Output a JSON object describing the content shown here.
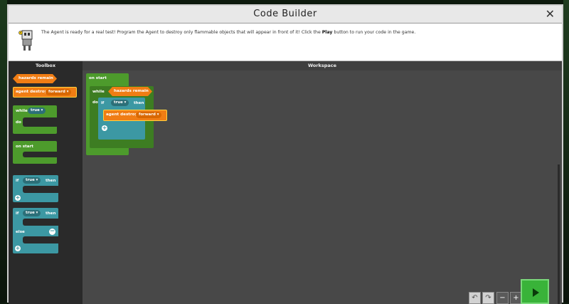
{
  "window": {
    "title": "Code Builder",
    "close_glyph": "✕"
  },
  "info": {
    "text_before": "The Agent is ready for a real test! Program the Agent to destroy only flammable objects that will appear in front of it! Click the ",
    "bold": "Play",
    "text_after": " button to run your code in the game."
  },
  "toolbox": {
    "header": "Toolbox",
    "hazards_label": "hazards remain",
    "agent_destroy_label": "agent destroy",
    "forward_label": "forward ▾",
    "while_label": "while",
    "true_label": "true ▾",
    "do_label": "do",
    "on_start_label": "on start",
    "if_label": "if",
    "then_label": "then",
    "else_label": "else"
  },
  "workspace": {
    "header": "Workspace",
    "on_start_label": "on start",
    "while_label": "while",
    "hazards_label": "hazards remain",
    "do_label": "do",
    "if_label": "if",
    "true_label": "true ▾",
    "then_label": "then",
    "agent_destroy_label": "agent destroy",
    "forward_label": "forward ▾"
  },
  "controls": {
    "undo": "↶",
    "redo": "↷",
    "zoom_out": "−",
    "zoom_in": "+"
  },
  "colors": {
    "loops_green": "#4d9b2c",
    "logic_teal": "#3c98a3",
    "agent_orange": "#f07d14",
    "play_green": "#39b339"
  }
}
